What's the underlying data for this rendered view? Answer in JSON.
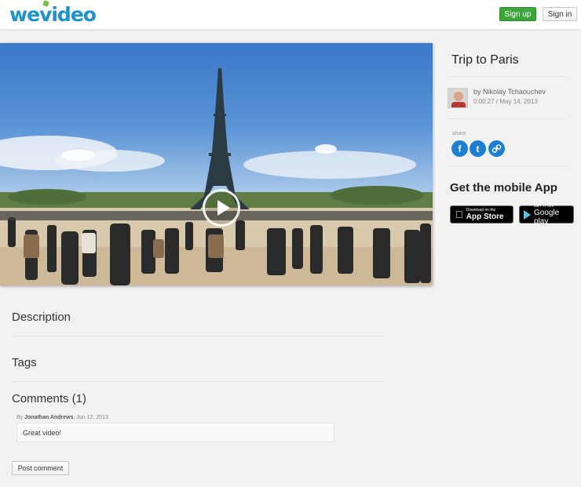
{
  "header": {
    "logo_text_a": "we",
    "logo_text_b": "video",
    "signup_label": "Sign up",
    "signin_label": "Sign in"
  },
  "video": {
    "play_icon": "play-icon"
  },
  "sidebar": {
    "title": "Trip to Paris",
    "author_prefix": "by",
    "author_name": "Nikolay Tchaouchev",
    "meta": "0:00:27 / May 14, 2013",
    "share_label": "share",
    "share_icons": [
      "facebook-icon",
      "twitter-icon",
      "link-icon"
    ],
    "app_title": "Get the mobile App",
    "app_store_small": "Download on the",
    "app_store_big": "App Store",
    "google_play_small": "GET IT ON",
    "google_play_big": "Google play"
  },
  "main": {
    "description_heading": "Description",
    "tags_heading": "Tags",
    "comments_heading": "Comments (1)",
    "comments": [
      {
        "by_prefix": "By",
        "author": "Jonathan Andrews",
        "date": ", Jun 12, 2013",
        "text": "Great video!"
      }
    ],
    "post_comment_label": "Post comment"
  },
  "colors": {
    "brand_blue": "#1f92c9",
    "signup_green": "#3ea53d",
    "share_blue": "#1c7fd0"
  }
}
